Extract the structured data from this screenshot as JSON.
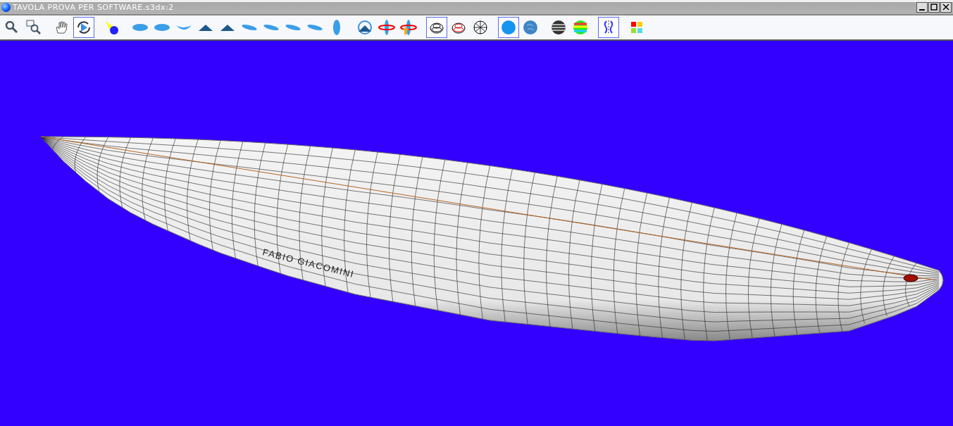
{
  "window": {
    "title": "TAVOLA PROVA PER SOFTWARE.s3dx:2"
  },
  "toolbar": {
    "groups": [
      [
        {
          "kind": "zoom",
          "selected": false
        },
        {
          "kind": "zoom-window",
          "selected": false
        }
      ],
      [
        {
          "kind": "pan",
          "selected": false
        },
        {
          "kind": "rotate",
          "selected": true
        }
      ],
      [
        {
          "kind": "light",
          "selected": false
        }
      ],
      [
        {
          "kind": "top",
          "selected": false
        },
        {
          "kind": "bottom",
          "selected": false
        },
        {
          "kind": "side",
          "selected": false
        },
        {
          "kind": "front",
          "selected": false
        },
        {
          "kind": "back",
          "selected": false
        },
        {
          "kind": "persp1",
          "selected": false
        },
        {
          "kind": "persp2",
          "selected": false
        },
        {
          "kind": "persp3",
          "selected": false
        },
        {
          "kind": "persp4",
          "selected": false
        },
        {
          "kind": "vertical",
          "selected": false
        }
      ],
      [
        {
          "kind": "spin",
          "selected": false
        },
        {
          "kind": "rotx",
          "selected": false
        },
        {
          "kind": "rotmove",
          "selected": false
        }
      ],
      [
        {
          "kind": "outline",
          "selected": true
        },
        {
          "kind": "outline-red",
          "selected": false
        },
        {
          "kind": "mesh",
          "selected": false
        }
      ],
      [
        {
          "kind": "solid",
          "selected": true
        },
        {
          "kind": "textured",
          "selected": false
        }
      ],
      [
        {
          "kind": "striped",
          "selected": false
        },
        {
          "kind": "rainbow",
          "selected": false
        }
      ],
      [
        {
          "kind": "symmetry",
          "selected": true
        }
      ],
      [
        {
          "kind": "palette",
          "selected": false
        }
      ]
    ]
  },
  "viewport": {
    "board_logo": "FABIO GIACOMINI"
  }
}
